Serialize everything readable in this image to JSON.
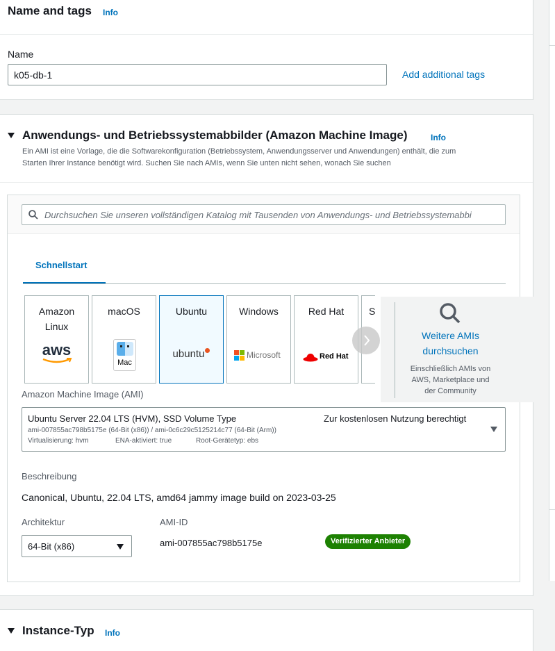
{
  "name_and_tags": {
    "title": "Name and tags",
    "info": "Info",
    "name_label": "Name",
    "name_value": "k05-db-1",
    "add_tags": "Add additional tags"
  },
  "ami_section": {
    "title": "Anwendungs- und Betriebssystemabbilder (Amazon Machine Image)",
    "info": "Info",
    "desc_line1": "Ein AMI ist eine Vorlage, die die Softwarekonfiguration (Betriebssystem, Anwendungsserver und Anwendungen) enthält, die zum",
    "desc_line2": "Starten Ihrer Instance benötigt wird. Suchen Sie nach AMIs, wenn Sie unten nicht sehen, wonach Sie suchen",
    "search_placeholder": "Durchsuchen Sie unseren vollständigen Katalog mit Tausenden von Anwendungs- und Betriebssystemabbi",
    "tab_quickstart": "Schnellstart",
    "tiles": [
      {
        "l1": "Amazon",
        "l2": "Linux",
        "logo": "aws"
      },
      {
        "l1": "macOS",
        "l2": "",
        "logo": "Mac"
      },
      {
        "l1": "Ubuntu",
        "l2": "",
        "logo": "ubuntu"
      },
      {
        "l1": "Windows",
        "l2": "",
        "logo": "Microsoft"
      },
      {
        "l1": "Red Hat",
        "l2": "",
        "logo": "Red Hat"
      },
      {
        "l1": "S",
        "l2": "",
        "logo": ""
      }
    ],
    "browse_more_l1": "Weitere AMIs",
    "browse_more_l2": "durchsuchen",
    "browse_more_note_l1": "Einschließlich AMIs von",
    "browse_more_note_l2": "AWS, Marketplace und",
    "browse_more_note_l3": "der Community",
    "ami_label": "Amazon Machine Image (AMI)",
    "ami_name": "Ubuntu Server 22.04 LTS (HVM), SSD Volume Type",
    "ami_free_tier": "Zur kostenlosen Nutzung berechtigt",
    "ami_ids": "ami-007855ac798b5175e (64-Bit (x86)) / ami-0c6c29c5125214c77 (64-Bit (Arm))",
    "ami_virt": "Virtualisierung: hvm",
    "ami_ena": "ENA-aktiviert: true",
    "ami_root": "Root-Gerätetyp: ebs",
    "desc_label": "Beschreibung",
    "desc_value": "Canonical, Ubuntu, 22.04 LTS, amd64 jammy image build on 2023-03-25",
    "arch_label": "Architektur",
    "arch_value": "64-Bit (x86)",
    "amiid_label": "AMI-ID",
    "amiid_value": "ami-007855ac798b5175e",
    "verified_badge": "Verifizierter Anbieter"
  },
  "instance_type": {
    "title": "Instance-Typ",
    "info": "Info"
  },
  "colors": {
    "link": "#0073bb",
    "badge_green": "#1d8102",
    "selected_tile_bg": "#f1faff"
  }
}
